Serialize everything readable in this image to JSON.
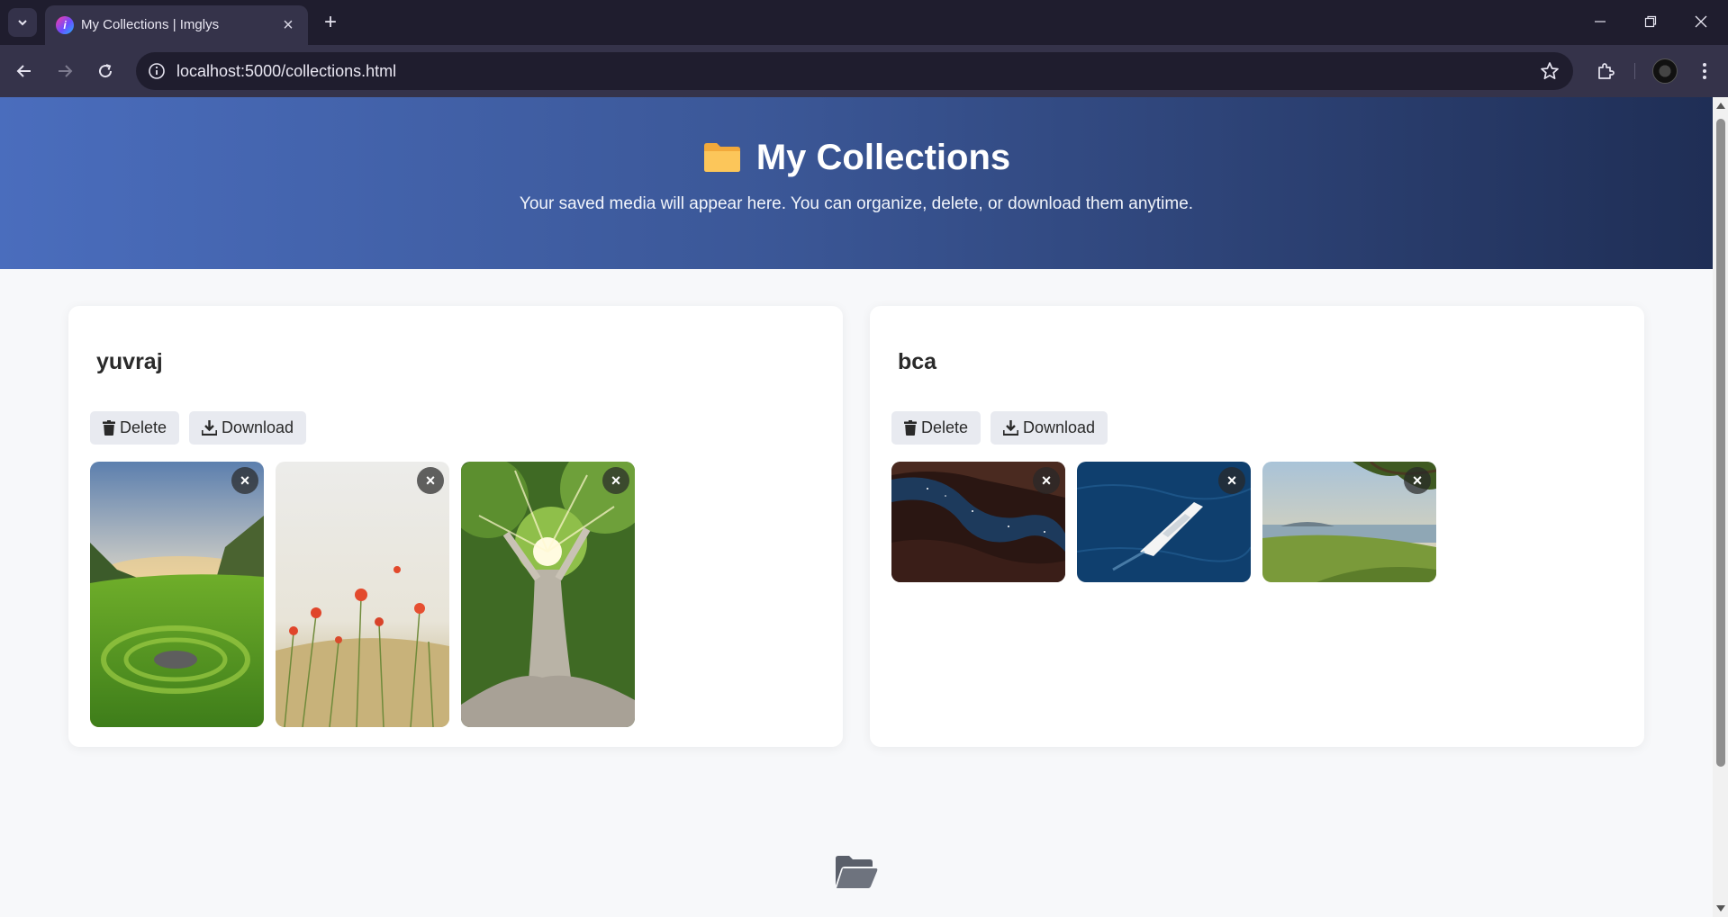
{
  "browser": {
    "tab_title": "My Collections | Imglys",
    "url": "localhost:5000/collections.html"
  },
  "hero": {
    "title": "My Collections",
    "subtitle": "Your saved media will appear here. You can organize, delete, or download them anytime."
  },
  "collections": [
    {
      "name": "yuvraj",
      "delete_label": "Delete",
      "download_label": "Download",
      "images": [
        "green valley stone spiral at sunset",
        "red poppies in wheat field",
        "large banyan tree with sunlight"
      ]
    },
    {
      "name": "bca",
      "delete_label": "Delete",
      "download_label": "Download",
      "images": [
        "canyon view of starry night sky",
        "aerial view of white yacht on blue sea",
        "tree over grassy coast at sunset"
      ]
    }
  ],
  "icons": {
    "remove": "×",
    "tab_close": "×",
    "new_tab": "+"
  },
  "colors": {
    "hero_start": "#4a6dbd",
    "hero_end": "#1f2e55",
    "button_bg": "#e8eaf0",
    "folder_yellow": "#f6b73c",
    "chrome_dark": "#1f1d2e",
    "chrome_mid": "#35334a"
  }
}
